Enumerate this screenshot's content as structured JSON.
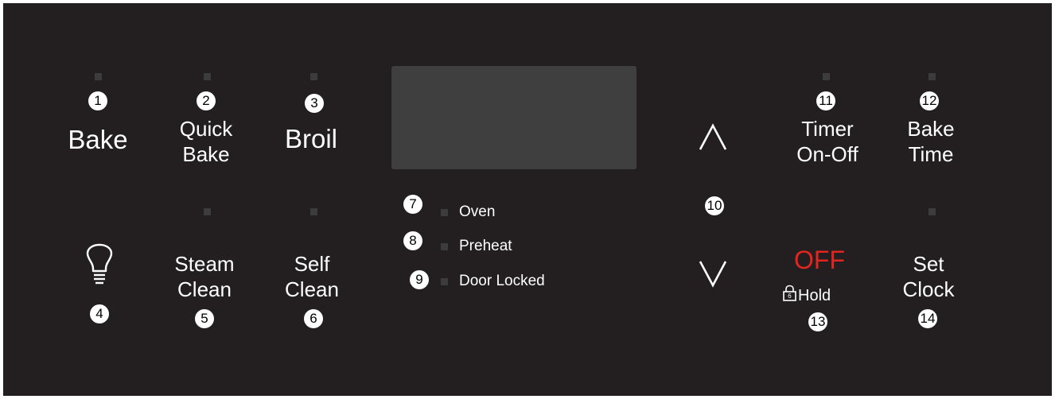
{
  "panel": {
    "background": "#231f20",
    "keys": {
      "bake": {
        "number": "1",
        "label": "Bake"
      },
      "quick_bake": {
        "number": "2",
        "line1": "Quick",
        "line2": "Bake"
      },
      "broil": {
        "number": "3",
        "label": "Broil"
      },
      "light": {
        "number": "4",
        "icon": "lightbulb-icon"
      },
      "steam_clean": {
        "number": "5",
        "line1": "Steam",
        "line2": "Clean"
      },
      "self_clean": {
        "number": "6",
        "line1": "Self",
        "line2": "Clean"
      },
      "arrows": {
        "number": "10",
        "up_icon": "chevron-up-icon",
        "down_icon": "chevron-down-icon"
      },
      "timer": {
        "number": "11",
        "line1": "Timer",
        "line2": "On-Off"
      },
      "bake_time": {
        "number": "12",
        "line1": "Bake",
        "line2": "Time"
      },
      "off": {
        "number": "13",
        "label": "OFF",
        "hold_label": "Hold",
        "lock_digit": "6",
        "color": "#e2251f"
      },
      "set_clock": {
        "number": "14",
        "line1": "Set",
        "line2": "Clock"
      }
    },
    "indicators": [
      {
        "number": "7",
        "label": "Oven"
      },
      {
        "number": "8",
        "label": "Preheat"
      },
      {
        "number": "9",
        "label": "Door Locked"
      }
    ],
    "display": {
      "color": "#3f3f3f"
    }
  }
}
